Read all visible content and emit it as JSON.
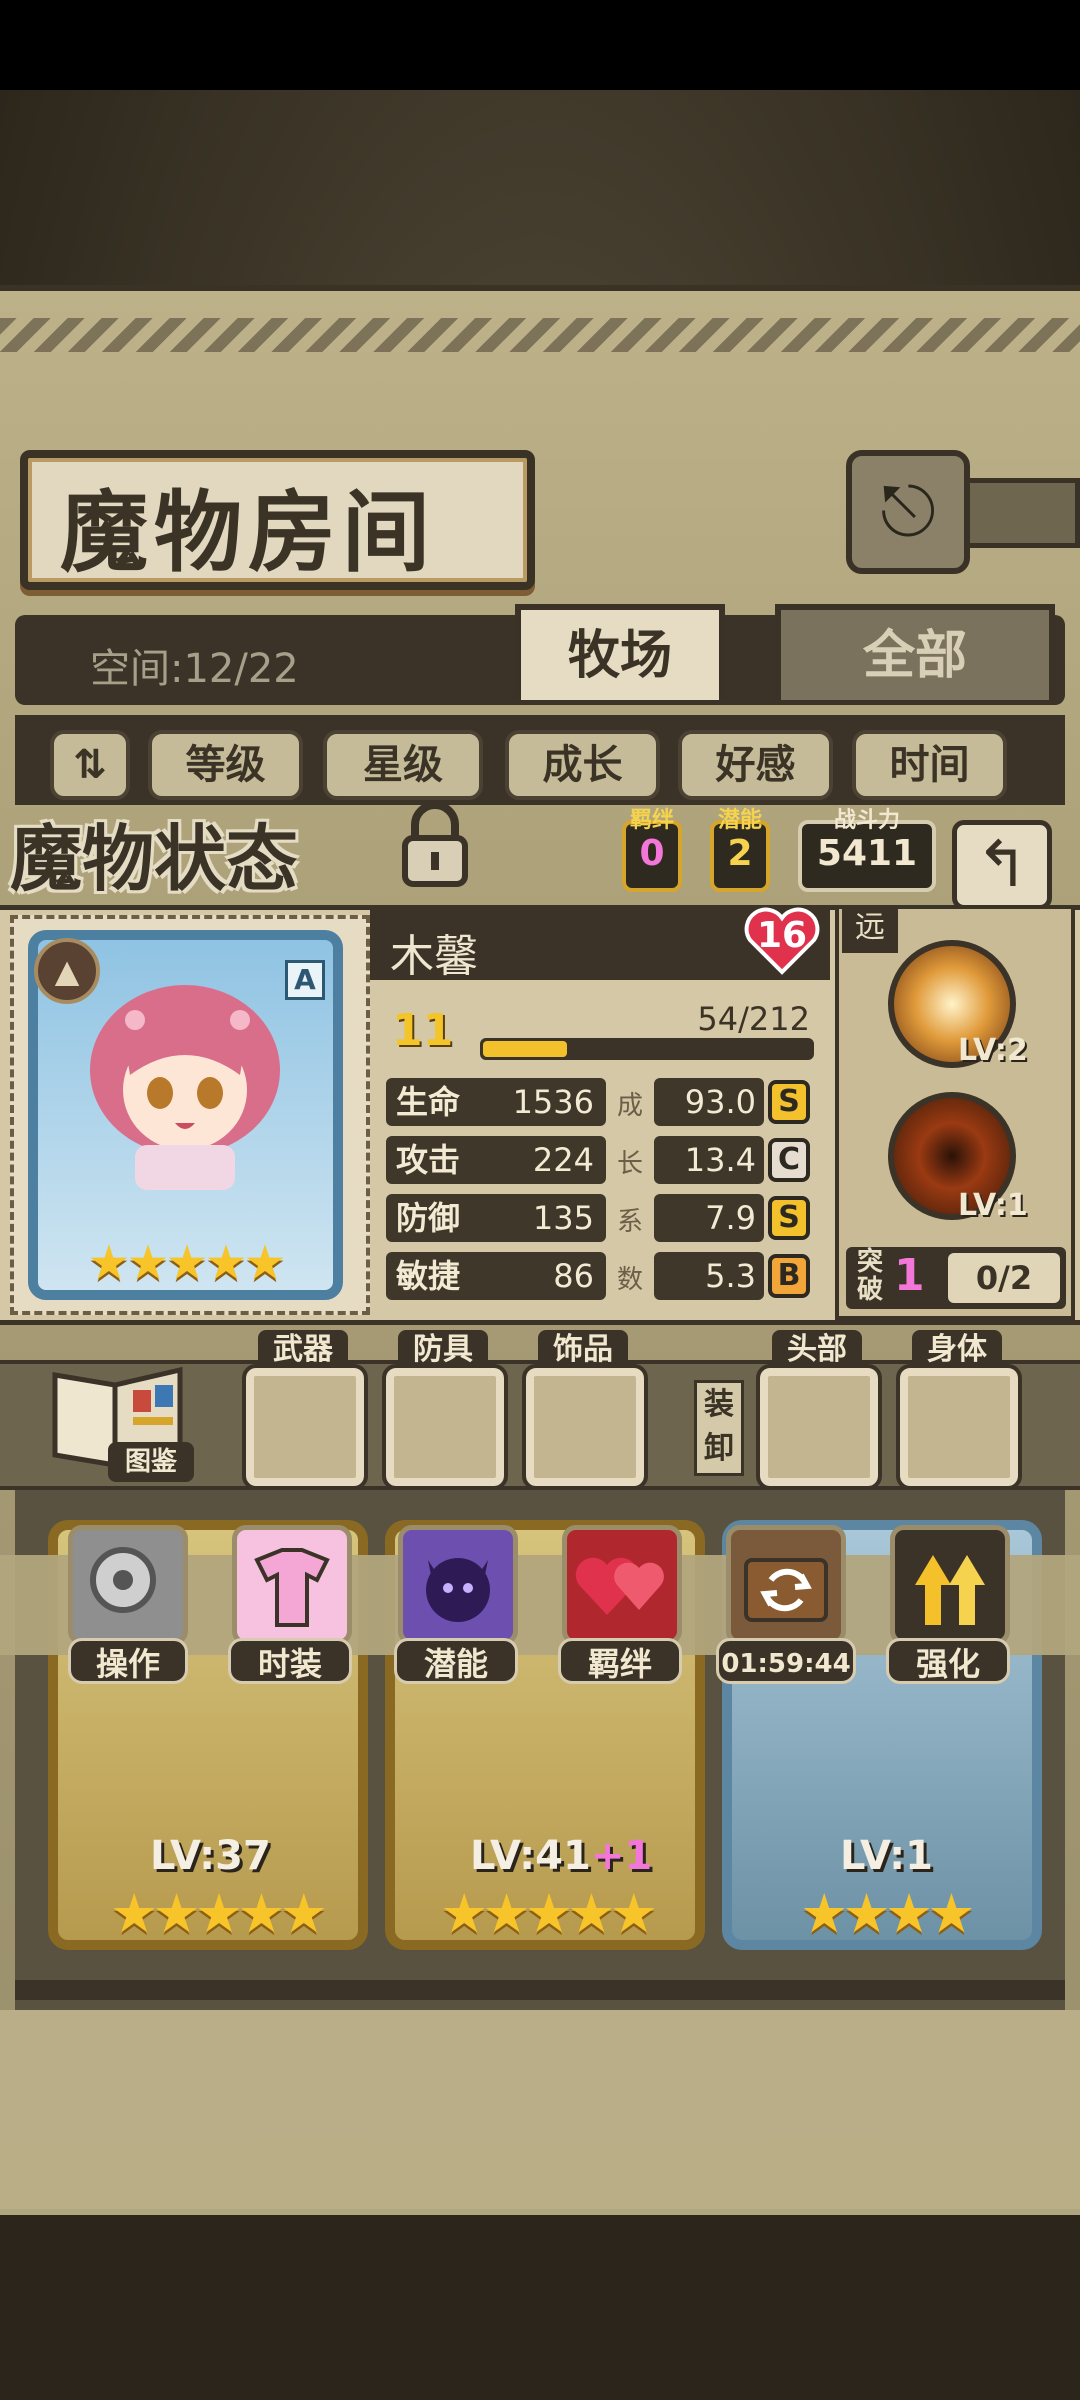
{
  "header": {
    "title": "魔物房间",
    "exit_icon": "exit-arrow-icon"
  },
  "tabs": {
    "space_label": "空间:12/22",
    "items": [
      {
        "label": "牧场",
        "active": true
      },
      {
        "label": "全部",
        "active": false
      }
    ]
  },
  "filters": {
    "sort_icon": "sort-order-icon",
    "items": [
      "等级",
      "星级",
      "成长",
      "好感",
      "时间"
    ]
  },
  "status": {
    "title": "魔物状态",
    "bond_label": "羁绊",
    "bond_value": "0",
    "potential_label": "潜能",
    "potential_value": "2",
    "power_label": "战斗力",
    "power_value": "5411"
  },
  "monster": {
    "name": "木馨",
    "affection": "16",
    "level": "11",
    "exp": "54/212",
    "exp_fraction": 0.255,
    "rank": "A",
    "stars": "★★★★★",
    "stats": [
      {
        "label": "生命",
        "value": "1536",
        "growth": "93.0",
        "grade": "S",
        "grade_color": "#f2c12c"
      },
      {
        "label": "攻击",
        "value": "224",
        "growth": "13.4",
        "grade": "C",
        "grade_color": "#e6ddd0"
      },
      {
        "label": "防御",
        "value": "135",
        "growth": "7.9",
        "grade": "S",
        "grade_color": "#f2c12c"
      },
      {
        "label": "敏捷",
        "value": "86",
        "growth": "5.3",
        "grade": "B",
        "grade_color": "#f2a63a"
      }
    ],
    "growth_vertical": [
      "成",
      "长",
      "系",
      "数"
    ]
  },
  "skills": {
    "range": "远",
    "items": [
      {
        "level": "LV:2"
      },
      {
        "level": "LV:1"
      }
    ],
    "breakthrough_label": "突破",
    "breakthrough_value": "1",
    "breakthrough_progress": "0/2"
  },
  "equipment": {
    "book_label": "图鉴",
    "slots": [
      "武器",
      "防具",
      "饰品",
      "头部",
      "身体"
    ],
    "unequip_label": "装卸"
  },
  "menu": [
    {
      "label": "操作",
      "icon": "gear-icon"
    },
    {
      "label": "时装",
      "icon": "outfit-icon"
    },
    {
      "label": "潜能",
      "icon": "demon-icon"
    },
    {
      "label": "羁绊",
      "icon": "hearts-icon"
    },
    {
      "label": "01:59:44",
      "icon": "refresh-chest-icon"
    },
    {
      "label": "强化",
      "icon": "double-arrow-up-icon"
    }
  ],
  "monster_list": [
    {
      "level": "LV:37",
      "plus": "",
      "stars": "★★★★★"
    },
    {
      "level": "LV:41",
      "plus": "+1",
      "stars": "★★★★★"
    },
    {
      "level": "LV:1",
      "plus": "",
      "stars": "★★★★"
    }
  ]
}
